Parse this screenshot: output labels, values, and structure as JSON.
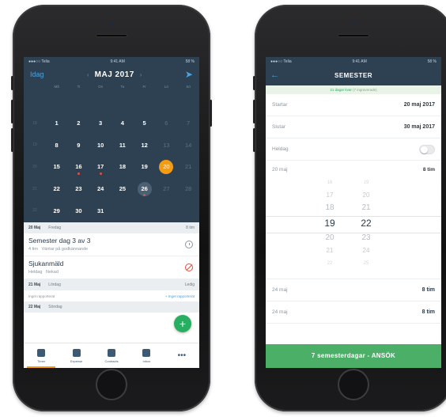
{
  "left": {
    "status": {
      "carrier": "●●●○○ Telia",
      "time": "9:41 AM",
      "battery": "58 %"
    },
    "header": {
      "today_label": "Idag",
      "month": "MAJ 2017",
      "prev": "‹",
      "next": "›",
      "send_icon": "paper-plane-icon"
    },
    "weekdays": [
      "",
      "Må",
      "Ti",
      "On",
      "To",
      "Fr",
      "Lö",
      "Sö"
    ],
    "weeks": [
      {
        "wk": "",
        "days": [
          "",
          "",
          "",
          "",
          "",
          "",
          ""
        ]
      },
      {
        "wk": "18",
        "days": [
          "1",
          "2",
          "3",
          "4",
          "5",
          "6",
          "7"
        ]
      },
      {
        "wk": "19",
        "days": [
          "8",
          "9",
          "10",
          "11",
          "12",
          "13",
          "14"
        ]
      },
      {
        "wk": "20",
        "days": [
          "15",
          "16",
          "17",
          "18",
          "19",
          "20",
          "21"
        ]
      },
      {
        "wk": "21",
        "days": [
          "22",
          "23",
          "24",
          "25",
          "26",
          "27",
          "28"
        ]
      },
      {
        "wk": "22",
        "days": [
          "29",
          "30",
          "31",
          "",
          "",
          "",
          ""
        ]
      }
    ],
    "day1": {
      "date": "20 Maj",
      "weekday": "Fredag",
      "right": "8 tim"
    },
    "entry1": {
      "title": "Semester",
      "sub": "dag 3 av 3",
      "hours": "4 tim",
      "status": "Väntar på godkännande"
    },
    "entry2": {
      "title": "Sjukanmäld",
      "hours": "Heldag",
      "status": "Nekad"
    },
    "day2": {
      "date": "21 Maj",
      "weekday": "Lördag",
      "right": "Ledig"
    },
    "row_none": {
      "left": "Inget rapporterat",
      "right": "+ Inget rapporterat"
    },
    "day3": {
      "date": "22 Maj",
      "weekday": "Söndag"
    },
    "fab": "+",
    "tabs": [
      {
        "label": "Timer",
        "icon": "stopwatch-icon"
      },
      {
        "label": "Expense",
        "icon": "receipt-icon"
      },
      {
        "label": "Contracts",
        "icon": "document-icon"
      },
      {
        "label": "Inbox",
        "icon": "inbox-icon"
      },
      {
        "label": "",
        "more": "•••"
      }
    ]
  },
  "right": {
    "status": {
      "carrier": "●●●○○ Telia",
      "time": "9:41 AM",
      "battery": "58 %"
    },
    "title": "SEMESTER",
    "back": "←",
    "banner": {
      "main": "21 dagar kvar",
      "sub": "(7 ingraverade)"
    },
    "start": {
      "label": "Startar",
      "value": "20 maj 2017"
    },
    "end": {
      "label": "Slutar",
      "value": "30 maj 2017"
    },
    "allday": {
      "label": "Heldag"
    },
    "picker": {
      "label": "20 maj",
      "value": "8 tim",
      "col1": [
        "16",
        "17",
        "18",
        "19",
        "20",
        "21",
        "22"
      ],
      "col2": [
        "19",
        "20",
        "21",
        "22",
        "23",
        "24",
        "25"
      ]
    },
    "day24": {
      "label": "24 maj",
      "value": "8 tim"
    },
    "day24b": {
      "label": "24 maj",
      "value": "8 tim"
    },
    "apply": "7 semesterdagar  -  ANSÖK"
  }
}
